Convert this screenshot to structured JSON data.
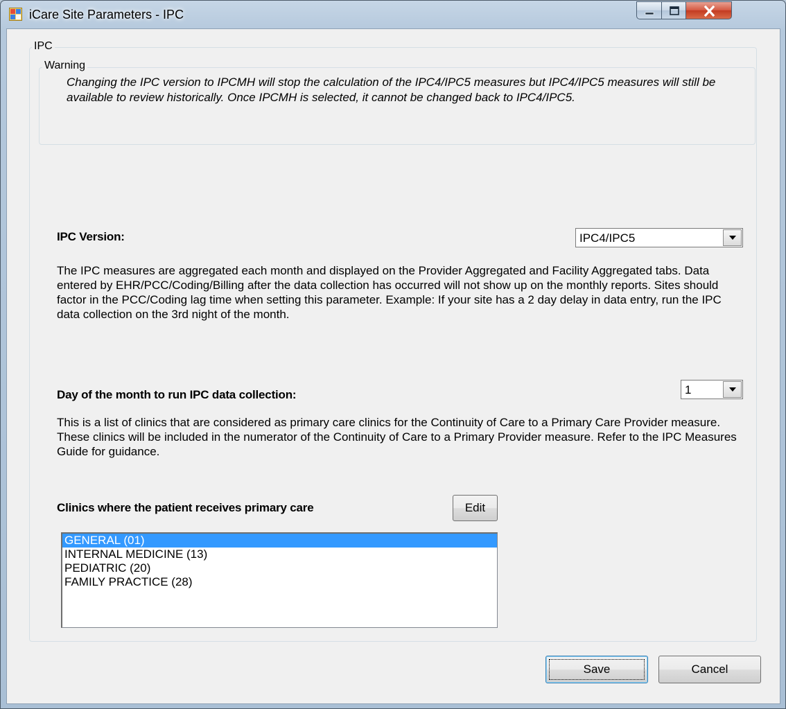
{
  "window": {
    "title": "iCare Site Parameters - IPC"
  },
  "group": {
    "legend": "IPC"
  },
  "warning": {
    "legend": "Warning",
    "text": "Changing the IPC version to IPCMH will stop the calculation of the IPC4/IPC5 measures but IPC4/IPC5 measures will still be available to review historically.  Once IPCMH is selected, it cannot be changed back to IPC4/IPC5."
  },
  "ipc_version": {
    "label": "IPC Version:",
    "selected": "IPC4/IPC5",
    "description": "The IPC measures are aggregated each month and displayed on the Provider Aggregated and Facility Aggregated tabs. Data entered by EHR/PCC/Coding/Billing after the data collection has occurred will not show up on the monthly reports.  Sites should factor in the PCC/Coding lag time when setting this parameter.  Example: If your site has a 2 day delay in data entry, run the IPC data collection on the 3rd night of the month."
  },
  "day_of_month": {
    "label": "Day of the month to run IPC data collection:",
    "selected": "1",
    "description": "This is a list of clinics that are considered as primary care clinics for the Continuity of Care to a Primary Care Provider measure.  These clinics will be included in the numerator of the Continuity of Care to a Primary Provider measure.  Refer to the IPC Measures Guide for guidance."
  },
  "clinics": {
    "label": "Clinics where the patient receives primary care",
    "edit_label": "Edit",
    "items": [
      {
        "label": "GENERAL (01)",
        "selected": true
      },
      {
        "label": "INTERNAL MEDICINE (13)",
        "selected": false
      },
      {
        "label": "PEDIATRIC (20)",
        "selected": false
      },
      {
        "label": "FAMILY PRACTICE (28)",
        "selected": false
      }
    ]
  },
  "footer": {
    "save_label": "Save",
    "cancel_label": "Cancel"
  }
}
